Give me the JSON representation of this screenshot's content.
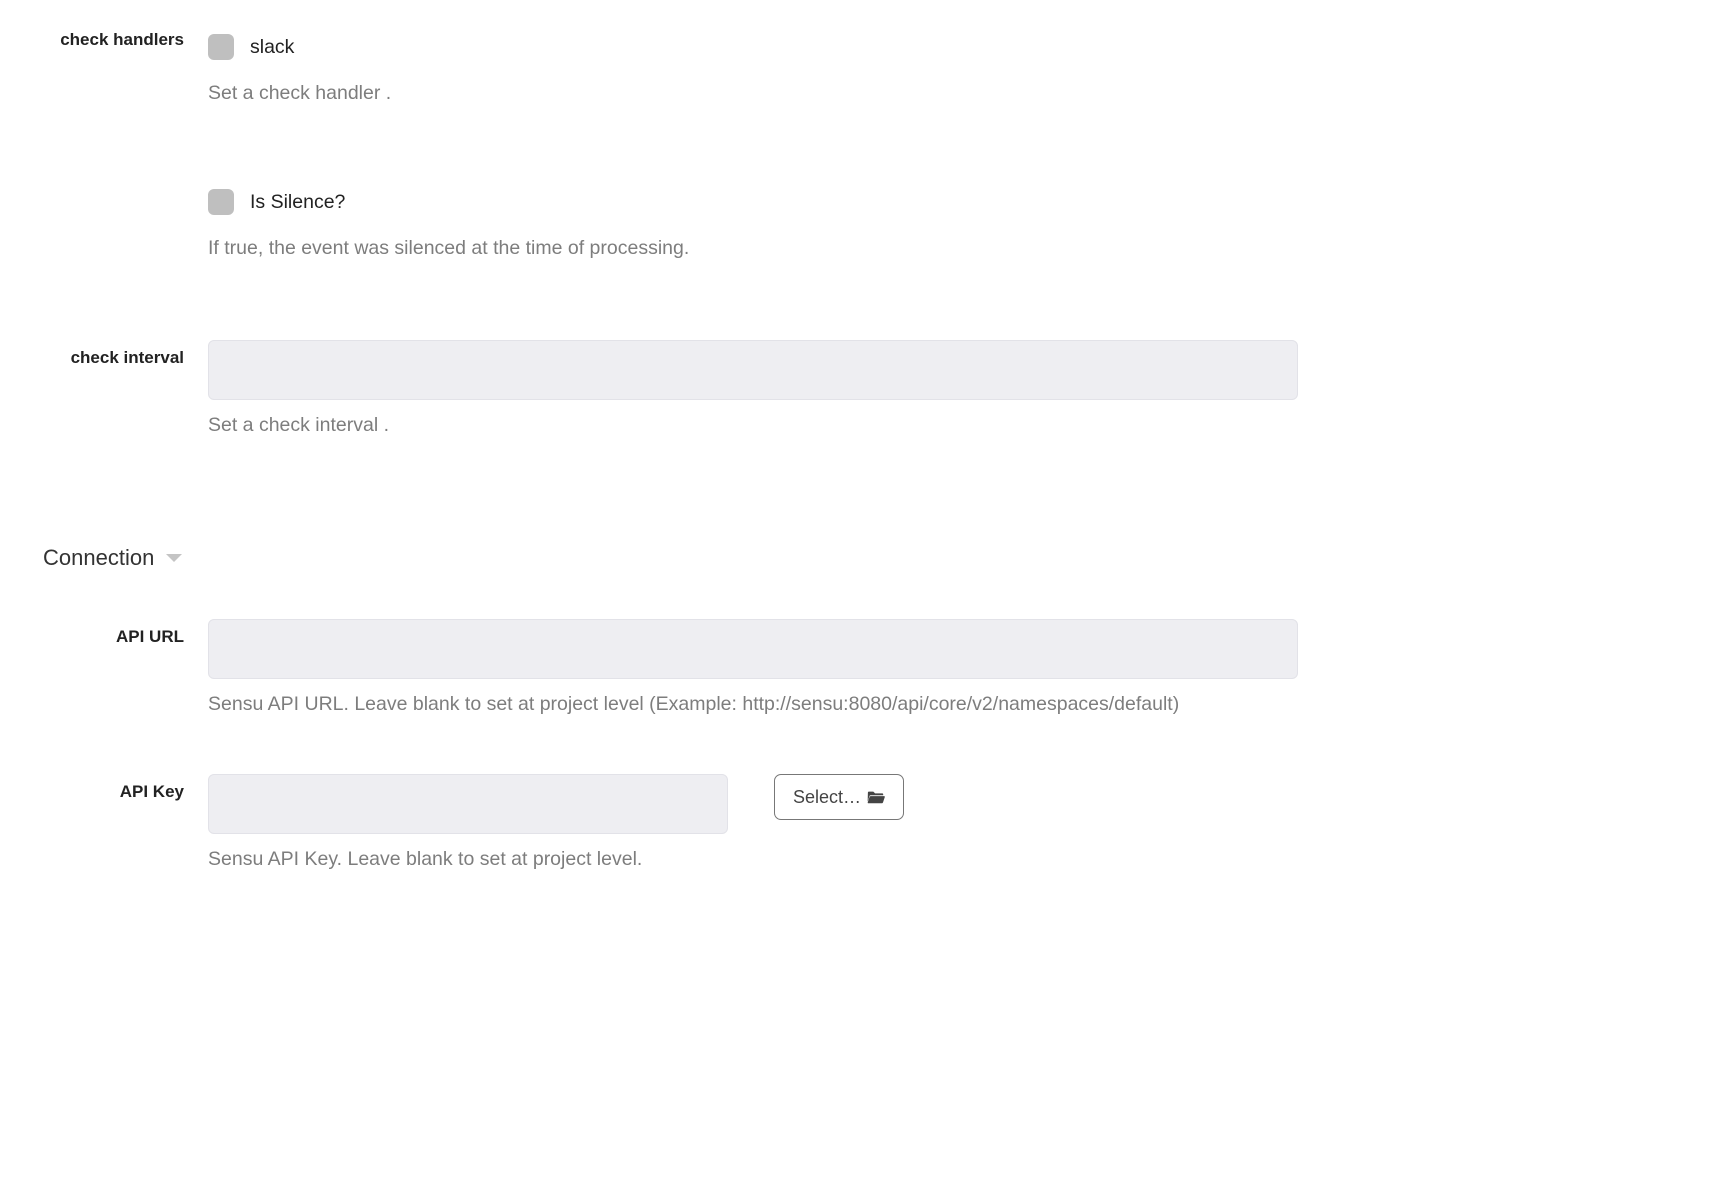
{
  "fields": {
    "check_handlers": {
      "label": "check handlers",
      "options": [
        {
          "label": "slack"
        }
      ],
      "help": "Set a check handler ."
    },
    "is_silence": {
      "label": "Is Silence?",
      "help": "If true, the event was silenced at the time of processing."
    },
    "check_interval": {
      "label": "check interval",
      "value": "",
      "help": "Set a check interval ."
    },
    "api_url": {
      "label": "API URL",
      "value": "",
      "help": "Sensu API URL. Leave blank to set at project level (Example: http://sensu:8080/api/core/v2/namespaces/default)"
    },
    "api_key": {
      "label": "API Key",
      "value": "",
      "help": "Sensu API Key. Leave blank to set at project level.",
      "select_button": "Select…"
    }
  },
  "section": {
    "connection": "Connection"
  }
}
